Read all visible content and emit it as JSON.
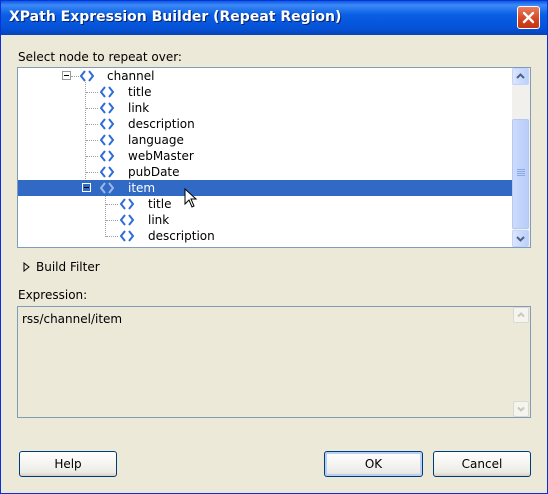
{
  "window": {
    "title": "XPath Expression Builder (Repeat Region)"
  },
  "tree_label": "Select node to repeat over:",
  "tree": {
    "nodes": [
      {
        "label": "channel",
        "level": 0,
        "expanded": true
      },
      {
        "label": "title",
        "level": 1
      },
      {
        "label": "link",
        "level": 1
      },
      {
        "label": "description",
        "level": 1
      },
      {
        "label": "language",
        "level": 1
      },
      {
        "label": "webMaster",
        "level": 1
      },
      {
        "label": "pubDate",
        "level": 1
      },
      {
        "label": "item",
        "level": 1,
        "expanded": true,
        "selected": true
      },
      {
        "label": "title",
        "level": 2
      },
      {
        "label": "link",
        "level": 2
      },
      {
        "label": "description",
        "level": 2
      }
    ]
  },
  "build_filter_label": "Build Filter",
  "expression_label": "Expression:",
  "expression_value": "rss/channel/item",
  "buttons": {
    "help": "Help",
    "ok": "OK",
    "cancel": "Cancel"
  },
  "colors": {
    "selection": "#316ac5",
    "titlebar": "#0a5fe4",
    "node_icon": "#2f6cd6"
  },
  "icons": {
    "close": "close-icon",
    "node": "xml-element-icon",
    "expander": "tree-expander-icon",
    "filter": "triangle-right-icon"
  }
}
